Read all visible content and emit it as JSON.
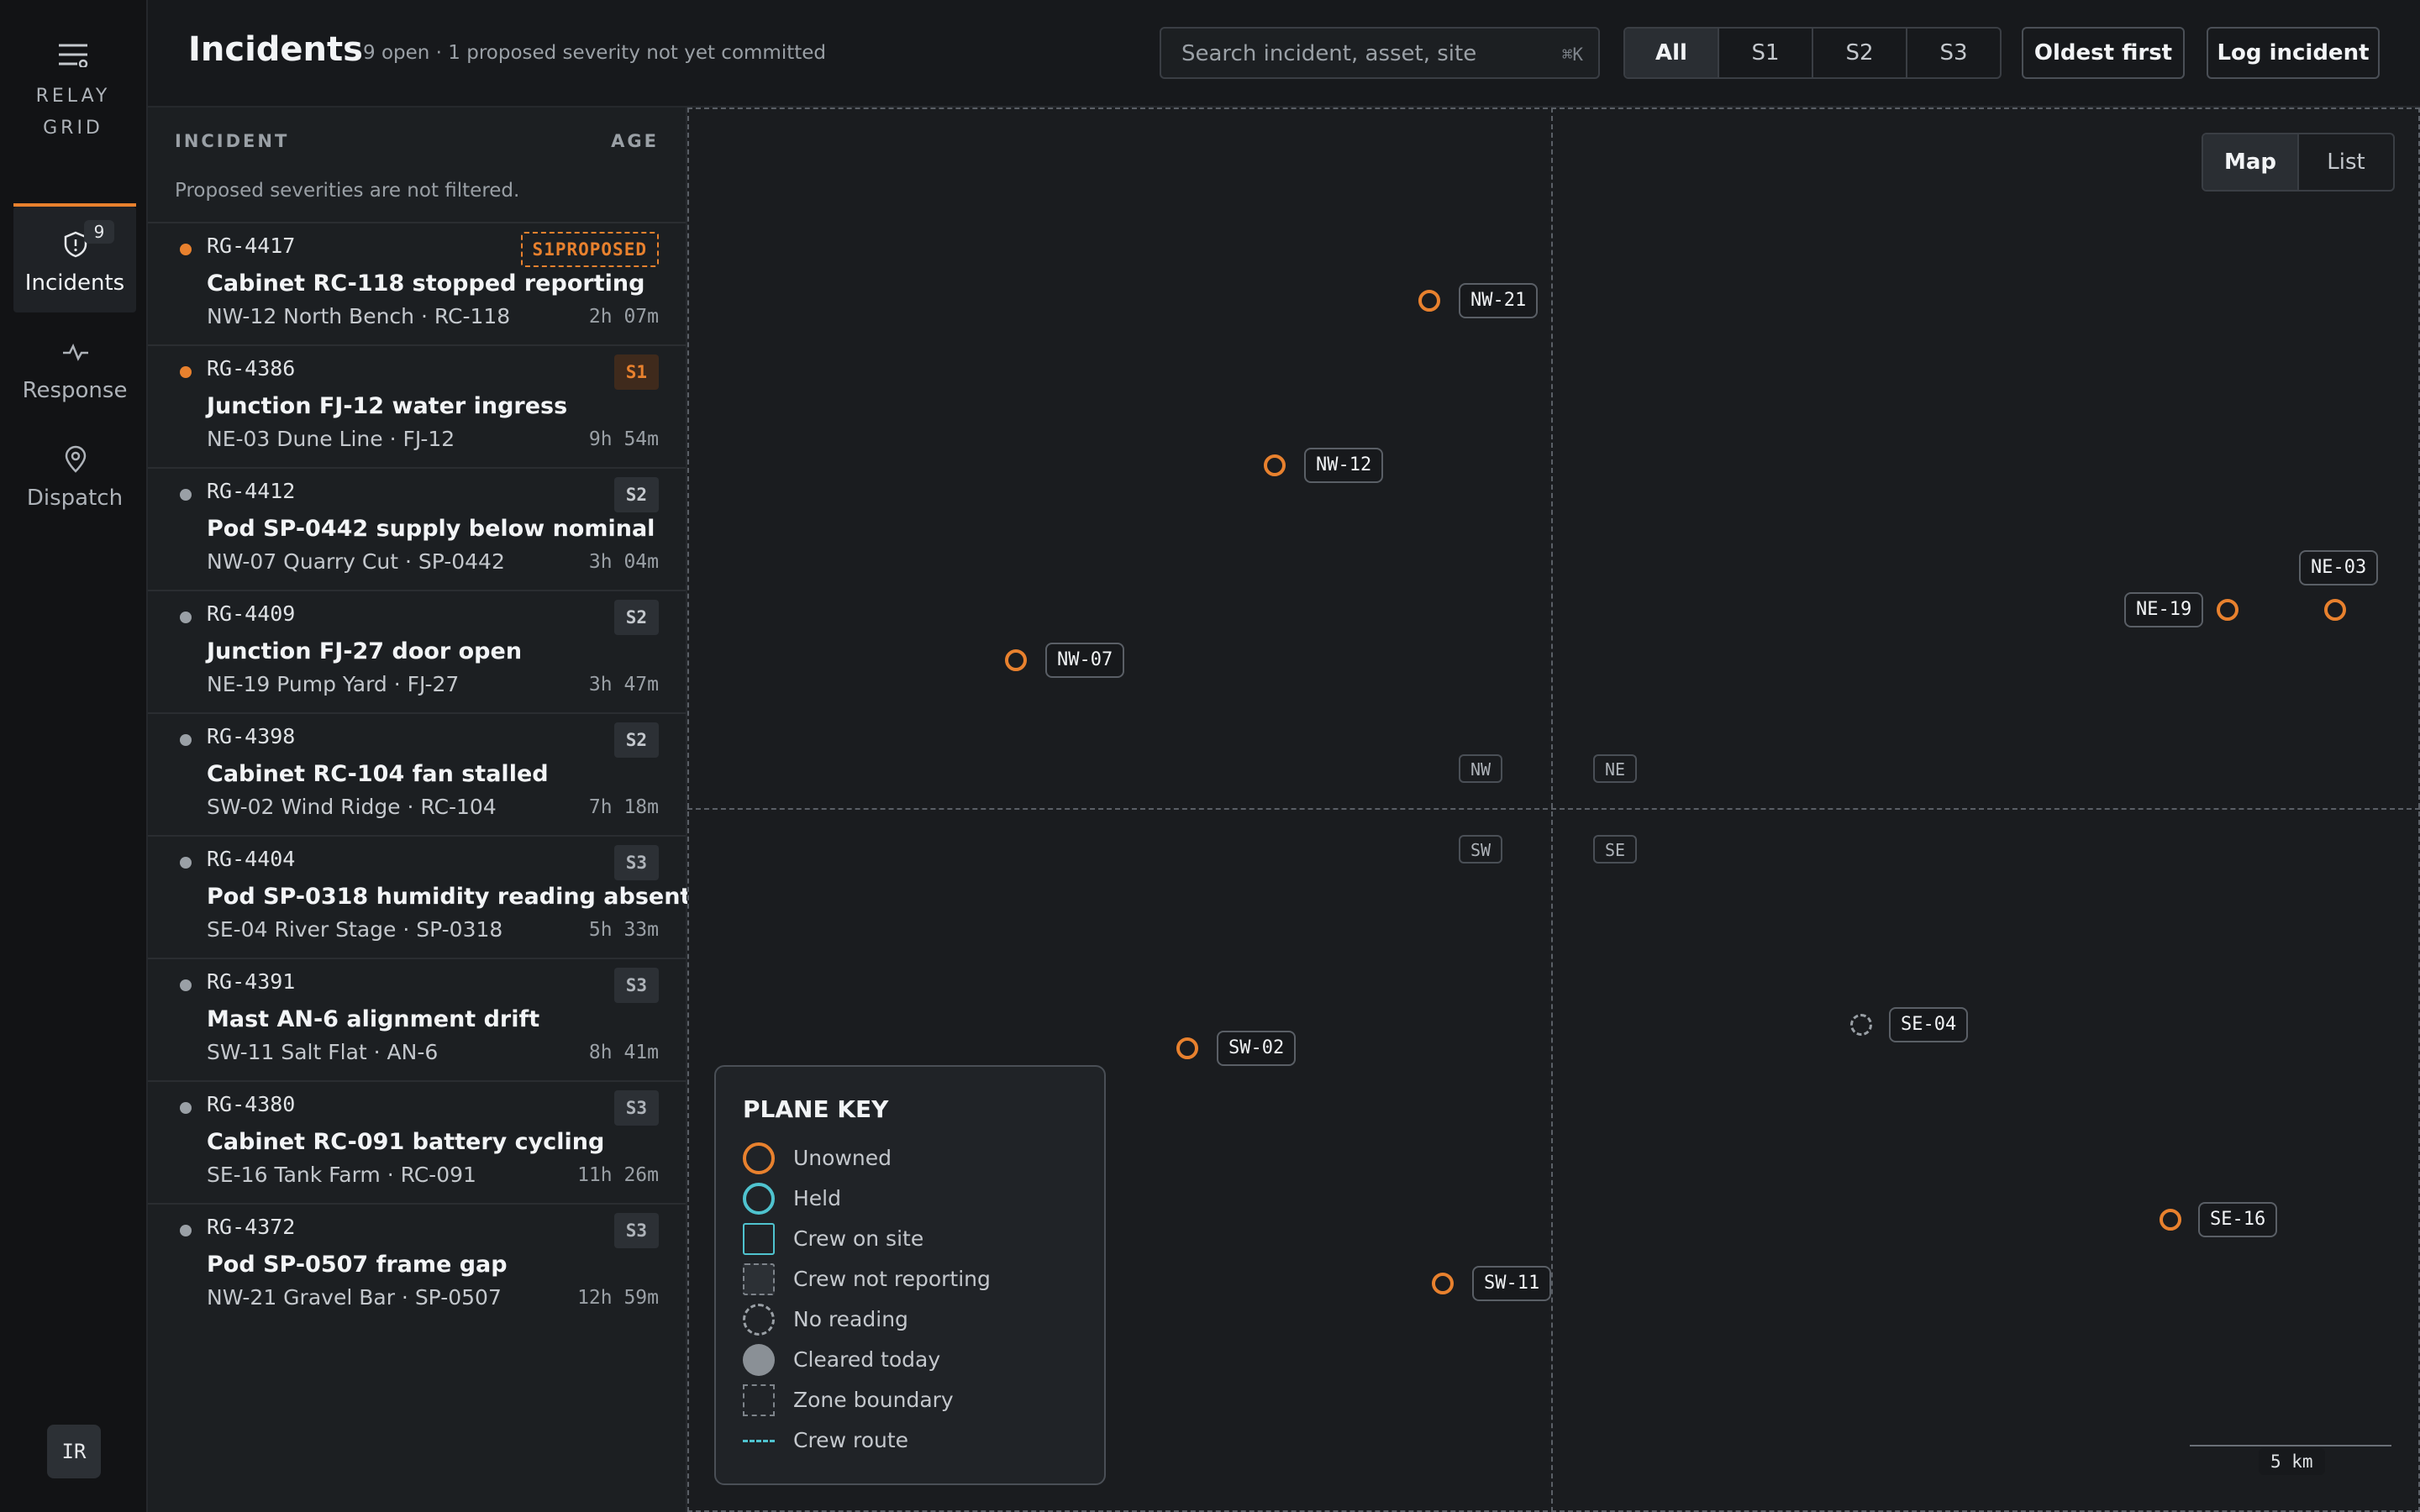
{
  "app": {
    "brand_line1": "RELAY",
    "brand_line2": "GRID",
    "user_initials": "IR"
  },
  "rail": {
    "items": [
      {
        "label": "Incidents",
        "icon": "shield-alert-icon",
        "badge": "9",
        "active": true
      },
      {
        "label": "Response",
        "icon": "pulse-icon",
        "active": false
      },
      {
        "label": "Dispatch",
        "icon": "map-pin-icon",
        "active": false
      }
    ]
  },
  "header": {
    "title": "Incidents",
    "subtitle": "9 open · 1 proposed severity not yet committed",
    "search_placeholder": "Search incident, asset, site",
    "search_shortcut": "⌘K",
    "severity_filter": [
      "All",
      "S1",
      "S2",
      "S3"
    ],
    "severity_selected": "All",
    "sort_label": "Oldest first",
    "log_label": "Log incident"
  },
  "list": {
    "col_incident": "INCIDENT",
    "col_age": "AGE",
    "note": "Proposed severities are not filtered.",
    "rows": [
      {
        "id": "RG-4417",
        "title": "Cabinet RC-118 stopped reporting",
        "location": "NW-12 North Bench · RC-118",
        "age": "2h 07m",
        "severity": "S1",
        "proposed_label": "PROPOSED",
        "proposed": true,
        "dot": "orange"
      },
      {
        "id": "RG-4386",
        "title": "Junction FJ-12 water ingress",
        "location": "NE-03 Dune Line · FJ-12",
        "age": "9h 54m",
        "severity": "S1",
        "proposed": false,
        "dot": "orange"
      },
      {
        "id": "RG-4412",
        "title": "Pod SP-0442 supply below nominal",
        "location": "NW-07 Quarry Cut · SP-0442",
        "age": "3h 04m",
        "severity": "S2",
        "proposed": false,
        "dot": "gray"
      },
      {
        "id": "RG-4409",
        "title": "Junction FJ-27 door open",
        "location": "NE-19 Pump Yard · FJ-27",
        "age": "3h 47m",
        "severity": "S2",
        "proposed": false,
        "dot": "gray"
      },
      {
        "id": "RG-4398",
        "title": "Cabinet RC-104 fan stalled",
        "location": "SW-02 Wind Ridge · RC-104",
        "age": "7h 18m",
        "severity": "S2",
        "proposed": false,
        "dot": "gray"
      },
      {
        "id": "RG-4404",
        "title": "Pod SP-0318 humidity reading absent",
        "location": "SE-04 River Stage · SP-0318",
        "age": "5h 33m",
        "severity": "S3",
        "proposed": false,
        "dot": "gray"
      },
      {
        "id": "RG-4391",
        "title": "Mast AN-6 alignment drift",
        "location": "SW-11 Salt Flat · AN-6",
        "age": "8h 41m",
        "severity": "S3",
        "proposed": false,
        "dot": "gray"
      },
      {
        "id": "RG-4380",
        "title": "Cabinet RC-091 battery cycling",
        "location": "SE-16 Tank Farm · RC-091",
        "age": "11h 26m",
        "severity": "S3",
        "proposed": false,
        "dot": "gray"
      },
      {
        "id": "RG-4372",
        "title": "Pod SP-0507 frame gap",
        "location": "NW-21 Gravel Bar · SP-0507",
        "age": "12h 59m",
        "severity": "S3",
        "proposed": false,
        "dot": "gray"
      }
    ]
  },
  "map": {
    "view_options": [
      "Map",
      "List"
    ],
    "view_selected": "Map",
    "zones": [
      "NW",
      "NE",
      "SW",
      "SE"
    ],
    "sites": [
      {
        "label": "NW-21",
        "status": "Unowned"
      },
      {
        "label": "NW-12",
        "status": "Unowned"
      },
      {
        "label": "NW-07",
        "status": "Unowned"
      },
      {
        "label": "NE-19",
        "status": "Unowned"
      },
      {
        "label": "NE-03",
        "status": "Unowned"
      },
      {
        "label": "SW-02",
        "status": "Unowned"
      },
      {
        "label": "SW-11",
        "status": "Unowned"
      },
      {
        "label": "SE-04",
        "status": "No reading"
      },
      {
        "label": "SE-16",
        "status": "Unowned"
      }
    ],
    "legend": {
      "title": "PLANE KEY",
      "items": [
        "Unowned",
        "Held",
        "Crew on site",
        "Crew not reporting",
        "No reading",
        "Cleared today",
        "Zone boundary",
        "Crew route"
      ]
    },
    "scale_label": "5 km"
  },
  "colors": {
    "accent": "#e8812e",
    "held": "#4fc3cf",
    "background": "#17191c"
  }
}
